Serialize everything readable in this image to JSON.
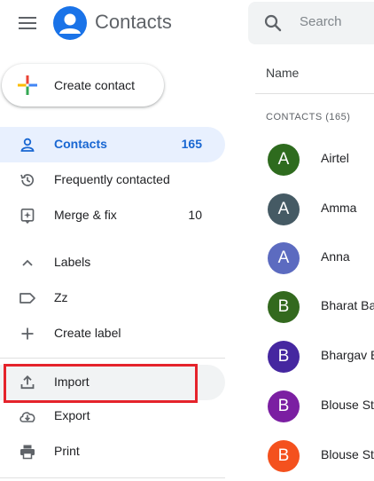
{
  "header": {
    "app_title": "Contacts",
    "search_placeholder": "Search"
  },
  "create_label": "Create contact",
  "nav": {
    "contacts": {
      "label": "Contacts",
      "count": "165"
    },
    "frequent": {
      "label": "Frequently contacted"
    },
    "merge": {
      "label": "Merge & fix",
      "count": "10"
    },
    "labels": {
      "label": "Labels"
    },
    "zz": {
      "label": "Zz"
    },
    "create_label": {
      "label": "Create label"
    },
    "import": {
      "label": "Import"
    },
    "export": {
      "label": "Export"
    },
    "print": {
      "label": "Print"
    }
  },
  "list": {
    "column_header": "Name",
    "section_label": "CONTACTS (165)",
    "contacts": [
      {
        "initial": "A",
        "name": "Airtel",
        "color": "#2e6b1e"
      },
      {
        "initial": "A",
        "name": "Amma",
        "color": "#455a64"
      },
      {
        "initial": "A",
        "name": "Anna",
        "color": "#5c6bc0"
      },
      {
        "initial": "B",
        "name": "Bharat Ba",
        "color": "#33691e"
      },
      {
        "initial": "B",
        "name": "Bhargav B",
        "color": "#4527a0"
      },
      {
        "initial": "B",
        "name": "Blouse St",
        "color": "#7b1fa2"
      },
      {
        "initial": "B",
        "name": "Blouse St",
        "color": "#f4511e"
      }
    ]
  },
  "colors": {
    "accent": "#1a73e8",
    "active_bg": "#e8f0fe",
    "highlight": "#e5232b"
  },
  "icons": [
    "hamburger-menu-icon",
    "contacts-logo-icon",
    "search-icon",
    "plus-icon",
    "person-icon",
    "history-icon",
    "merge-icon",
    "chevron-up-icon",
    "label-icon",
    "add-icon",
    "upload-icon",
    "cloud-download-icon",
    "print-icon"
  ]
}
